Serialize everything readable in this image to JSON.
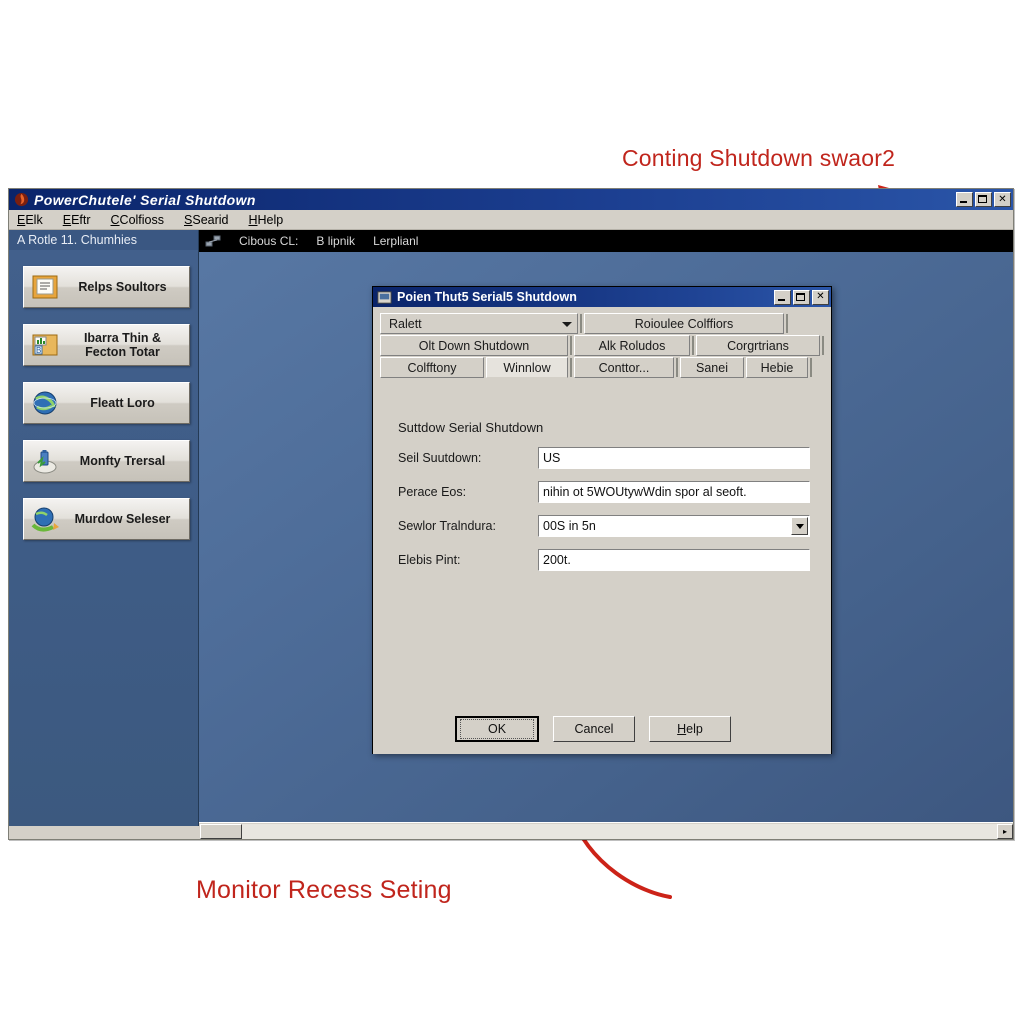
{
  "annotations": {
    "top": "Conting Shutdown swaor2",
    "bottom": "Monitor Recess Seting"
  },
  "main_window": {
    "title": "PowerChutele' Serial Shutdown",
    "title_icon": "app-flame-icon",
    "controls": {
      "minimize": "_",
      "maximize": "□",
      "close": "✕"
    },
    "menu": [
      {
        "label": "Elk",
        "accel": "E"
      },
      {
        "label": "Eftr",
        "accel": "E"
      },
      {
        "label": "Colfioss",
        "accel": "C"
      },
      {
        "label": "Searid",
        "accel": "S"
      },
      {
        "label": "Help",
        "accel": "H"
      }
    ],
    "sidebar": {
      "header": "A Rotle 11. Chumhies",
      "items": [
        {
          "label": "Relps Soultors",
          "icon": "documents-icon"
        },
        {
          "label": "Ibarra Thin &\nFecton Totar",
          "icon": "folder-chart-icon"
        },
        {
          "label": "Fleatt Loro",
          "icon": "globe-icon"
        },
        {
          "label": "Monfty Trersal",
          "icon": "battery-plug-icon"
        },
        {
          "label": "Murdow Seleser",
          "icon": "globe-refresh-icon"
        }
      ]
    },
    "canvas_toolbar": {
      "icon": "network-icon",
      "items": [
        "Cibous CL:",
        "B lipnik",
        "Lerplianl"
      ]
    },
    "scrollbar": {
      "right_arrow": "▸"
    }
  },
  "dialog": {
    "title": "Poien Thut5 Serial5 Shutdown",
    "title_icon": "dialog-app-icon",
    "controls": {
      "minimize": "_",
      "maximize": "□",
      "close": "✕"
    },
    "tab_rows": [
      [
        {
          "label": "Ralett",
          "type": "combo"
        },
        {
          "label": "Roioulee  Colffiors",
          "type": "tab"
        }
      ],
      [
        {
          "label": "Olt Down Shutdown",
          "type": "tab"
        },
        {
          "label": "Alk Roludos",
          "type": "tab"
        },
        {
          "label": "Corgrtrians",
          "type": "tab"
        }
      ],
      [
        {
          "label": "Colfftony",
          "type": "tab"
        },
        {
          "label": "Winnlow",
          "type": "tab",
          "active": true
        },
        {
          "label": "Conttor...",
          "type": "tab"
        },
        {
          "label": "Sanei",
          "type": "tab"
        },
        {
          "label": "Hebie",
          "type": "tab"
        }
      ]
    ],
    "heading": "Suttdow Serial Shutdown",
    "fields": [
      {
        "label": "Seil Suutdown:",
        "value": "US",
        "type": "text"
      },
      {
        "label": "Perace Eos:",
        "value": "nihin ot 5WOUtywWdin spor al seoft.",
        "type": "text"
      },
      {
        "label": "Sewlor Tralndura:",
        "value": "00S in 5n",
        "type": "select"
      },
      {
        "label": "Elebis Pint:",
        "value": "200t.",
        "type": "text"
      }
    ],
    "buttons": [
      {
        "label": "OK",
        "default": true
      },
      {
        "label": "Cancel",
        "default": false
      },
      {
        "label": "Help",
        "default": false,
        "accel": "H"
      }
    ]
  }
}
